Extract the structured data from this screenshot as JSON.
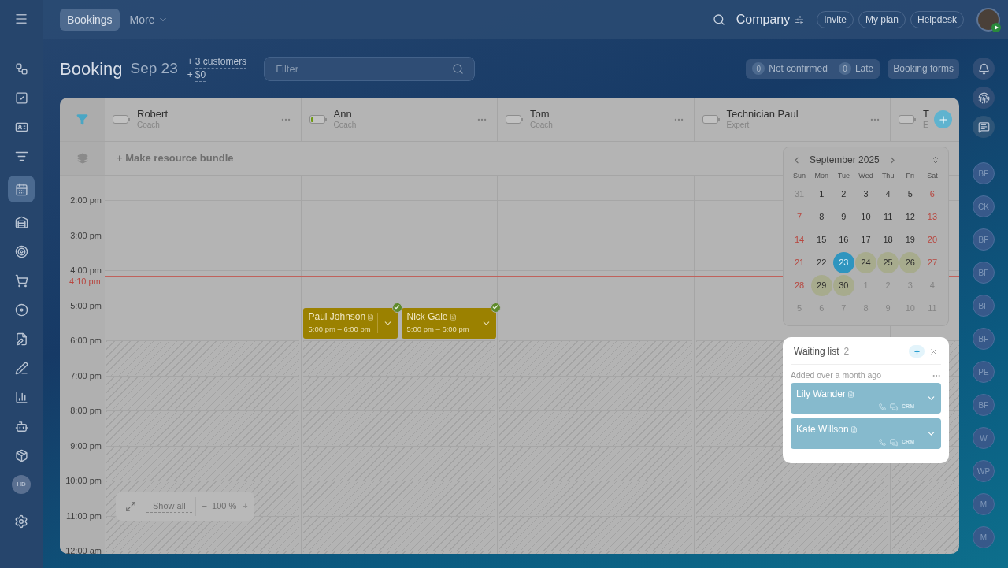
{
  "header": {
    "tabs": [
      {
        "label": "Bookings",
        "selected": true,
        "dropdown": false
      },
      {
        "label": "More",
        "selected": false,
        "dropdown": true
      }
    ],
    "company": "Company",
    "buttons": [
      "Invite",
      "My plan",
      "Helpdesk"
    ]
  },
  "left_sidebar": {
    "avatar": "HD"
  },
  "page": {
    "title": "Booking",
    "date": "Sep 23",
    "stats": [
      {
        "prefix": "+",
        "text": "3 customers"
      },
      {
        "prefix": "+",
        "text": "$0"
      }
    ],
    "filter": {
      "placeholder": "Filter"
    },
    "counters": [
      {
        "count": "0",
        "label": "Not confirmed"
      },
      {
        "count": "0",
        "label": "Late"
      }
    ],
    "booking_forms": "Booking forms"
  },
  "resources": [
    {
      "name": "Robert",
      "role": "Coach",
      "level": 0
    },
    {
      "name": "Ann",
      "role": "Coach",
      "level": 0.2,
      "bookings": [
        {
          "name": "Paul Johnson",
          "time": "5:00 pm – 6:00 pm",
          "confirmed": true
        },
        {
          "name": "Nick Gale",
          "time": "5:00 pm – 6:00 pm",
          "confirmed": true
        }
      ]
    },
    {
      "name": "Tom",
      "role": "Coach",
      "level": 0
    },
    {
      "name": "Technician Paul",
      "role": "Expert",
      "level": 0
    },
    {
      "name": "T",
      "role": "E",
      "level": 0
    }
  ],
  "bundle": "+ Make resource bundle",
  "hours": [
    {
      "label": "2:00 pm",
      "off": false
    },
    {
      "label": "3:00 pm",
      "off": false
    },
    {
      "label": "4:00 pm",
      "off": false
    },
    {
      "label": "5:00 pm",
      "off": false
    },
    {
      "label": "6:00 pm",
      "off": true
    },
    {
      "label": "7:00 pm",
      "off": true
    },
    {
      "label": "8:00 pm",
      "off": true
    },
    {
      "label": "9:00 pm",
      "off": true
    },
    {
      "label": "10:00 pm",
      "off": true
    },
    {
      "label": "11:00 pm",
      "off": true
    },
    {
      "label": "12:00 am",
      "off": true
    }
  ],
  "current_time": "4:10 pm",
  "zoom": {
    "show_all": "Show all",
    "minus": "−",
    "value": "100 %",
    "plus": "+"
  },
  "calendar": {
    "month": "September 2025",
    "weekdays": [
      "Sun",
      "Mon",
      "Tue",
      "Wed",
      "Thu",
      "Fri",
      "Sat"
    ],
    "weeks": [
      [
        {
          "day": "31",
          "muted": true,
          "selected": false,
          "booked": false
        },
        {
          "day": "1",
          "muted": false,
          "selected": false,
          "booked": false
        },
        {
          "day": "2",
          "muted": false,
          "selected": false,
          "booked": false
        },
        {
          "day": "3",
          "muted": false,
          "selected": false,
          "booked": false
        },
        {
          "day": "4",
          "muted": false,
          "selected": false,
          "booked": false
        },
        {
          "day": "5",
          "muted": false,
          "selected": false,
          "booked": false
        },
        {
          "day": "6",
          "muted": false,
          "selected": false,
          "booked": false
        }
      ],
      [
        {
          "day": "7",
          "muted": false,
          "selected": false,
          "booked": false
        },
        {
          "day": "8",
          "muted": false,
          "selected": false,
          "booked": false
        },
        {
          "day": "9",
          "muted": false,
          "selected": false,
          "booked": false
        },
        {
          "day": "10",
          "muted": false,
          "selected": false,
          "booked": false
        },
        {
          "day": "11",
          "muted": false,
          "selected": false,
          "booked": false
        },
        {
          "day": "12",
          "muted": false,
          "selected": false,
          "booked": false
        },
        {
          "day": "13",
          "muted": false,
          "selected": false,
          "booked": false
        }
      ],
      [
        {
          "day": "14",
          "muted": false,
          "selected": false,
          "booked": false
        },
        {
          "day": "15",
          "muted": false,
          "selected": false,
          "booked": false
        },
        {
          "day": "16",
          "muted": false,
          "selected": false,
          "booked": false
        },
        {
          "day": "17",
          "muted": false,
          "selected": false,
          "booked": false
        },
        {
          "day": "18",
          "muted": false,
          "selected": false,
          "booked": false
        },
        {
          "day": "19",
          "muted": false,
          "selected": false,
          "booked": false
        },
        {
          "day": "20",
          "muted": false,
          "selected": false,
          "booked": false
        }
      ],
      [
        {
          "day": "21",
          "muted": false,
          "selected": false,
          "booked": false
        },
        {
          "day": "22",
          "muted": false,
          "selected": false,
          "booked": false
        },
        {
          "day": "23",
          "muted": false,
          "selected": true,
          "booked": false
        },
        {
          "day": "24",
          "muted": false,
          "selected": false,
          "booked": true
        },
        {
          "day": "25",
          "muted": false,
          "selected": false,
          "booked": true
        },
        {
          "day": "26",
          "muted": false,
          "selected": false,
          "booked": true
        },
        {
          "day": "27",
          "muted": false,
          "selected": false,
          "booked": false
        }
      ],
      [
        {
          "day": "28",
          "muted": false,
          "selected": false,
          "booked": false
        },
        {
          "day": "29",
          "muted": false,
          "selected": false,
          "booked": true
        },
        {
          "day": "30",
          "muted": false,
          "selected": false,
          "booked": true
        },
        {
          "day": "1",
          "muted": true,
          "selected": false,
          "booked": false
        },
        {
          "day": "2",
          "muted": true,
          "selected": false,
          "booked": false
        },
        {
          "day": "3",
          "muted": true,
          "selected": false,
          "booked": false
        },
        {
          "day": "4",
          "muted": true,
          "selected": false,
          "booked": false
        }
      ],
      [
        {
          "day": "5",
          "muted": true,
          "selected": false,
          "booked": false
        },
        {
          "day": "6",
          "muted": true,
          "selected": false,
          "booked": false
        },
        {
          "day": "7",
          "muted": true,
          "selected": false,
          "booked": false
        },
        {
          "day": "8",
          "muted": true,
          "selected": false,
          "booked": false
        },
        {
          "day": "9",
          "muted": true,
          "selected": false,
          "booked": false
        },
        {
          "day": "10",
          "muted": true,
          "selected": false,
          "booked": false
        },
        {
          "day": "11",
          "muted": true,
          "selected": false,
          "booked": false
        }
      ]
    ]
  },
  "waiting_list": {
    "title": "Waiting list",
    "count": "2",
    "group": "Added over a month ago",
    "items": [
      {
        "name": "Lily Wander",
        "crm": "CRM"
      },
      {
        "name": "Kate Willson",
        "crm": "CRM"
      }
    ]
  },
  "right_sidebar": {
    "avatars": [
      "BF",
      "CK",
      "BF",
      "BF",
      "BF",
      "BF",
      "PE",
      "BF",
      "W",
      "WP",
      "M",
      "M"
    ]
  }
}
